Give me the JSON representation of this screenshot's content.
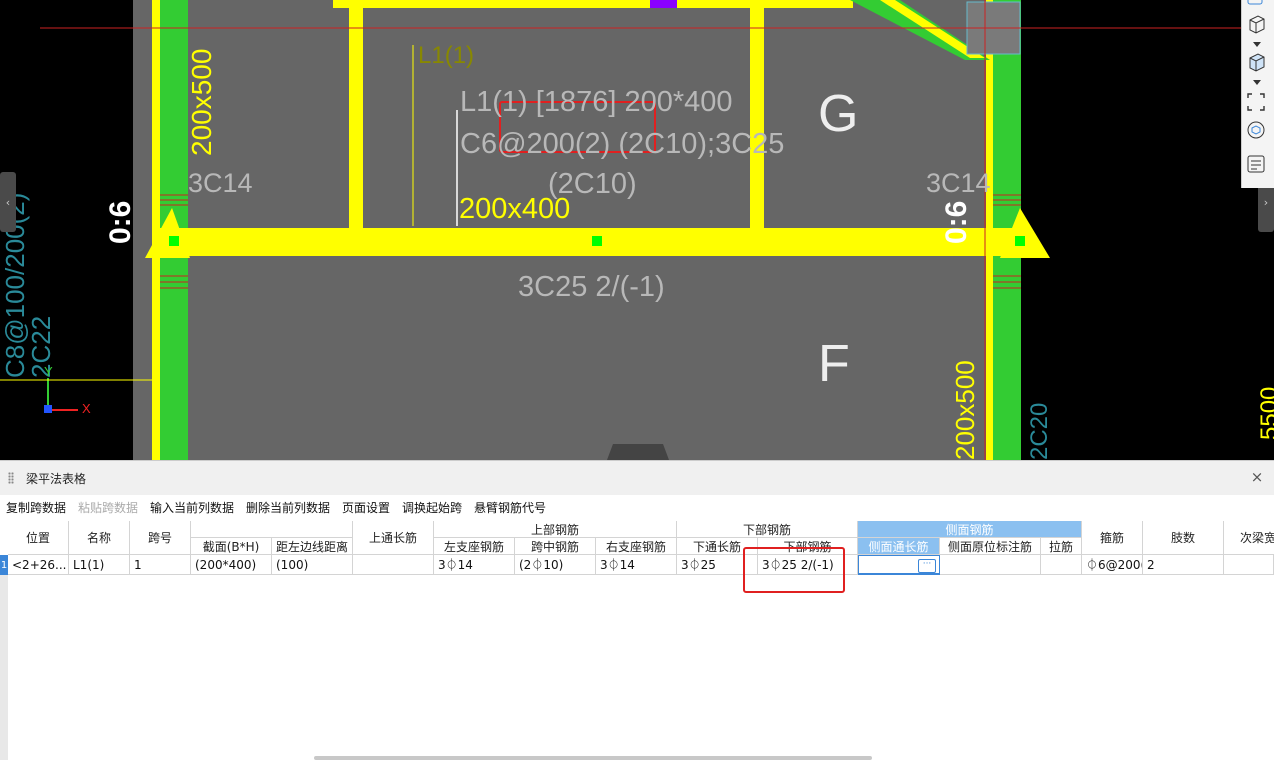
{
  "canvas": {
    "beam_label_line1": "L1(1) [1876] 200*400",
    "beam_label_line2": "C6@200(2) (2C10);3C25",
    "beam_label_line3": "(2C10)",
    "section_label": "200x400",
    "bottom_label": "3C25 2/(-1)",
    "left_section": "200x500",
    "left_rebar": "3C14",
    "right_rebar": "3C14",
    "left_dim": "0:6",
    "right_dim": "0:6",
    "axis_g": "G",
    "axis_f": "F",
    "lower_section": "200x500",
    "left_bg_text1": "C8@100/200(2)",
    "left_bg_text2": "2C22",
    "right_bg_text": "5500",
    "right_bg_text2": "2C20",
    "yellow_vertical_label": "L1(1)",
    "axis_x": "X",
    "axis_y": "Y",
    "colors": {
      "slab": "#666666",
      "beam": "#ffff00",
      "column": "#33cc33",
      "redline": "#cc2222"
    }
  },
  "toolbar_right": {
    "icons": [
      "3d-view-icon",
      "cube-icon",
      "cube-solid-icon",
      "fit-view-icon",
      "rotate-view-icon",
      "properties-list-icon"
    ]
  },
  "panel": {
    "title": "梁平法表格",
    "toolbar": [
      {
        "label": "复制跨数据",
        "enabled": true
      },
      {
        "label": "粘贴跨数据",
        "enabled": false
      },
      {
        "label": "输入当前列数据",
        "enabled": true
      },
      {
        "label": "删除当前列数据",
        "enabled": true
      },
      {
        "label": "页面设置",
        "enabled": true
      },
      {
        "label": "调换起始跨",
        "enabled": true
      },
      {
        "label": "悬臂钢筋代号",
        "enabled": true
      }
    ],
    "headers": {
      "position": "位置",
      "name": "名称",
      "span": "跨号",
      "section": "截面(B*H)",
      "offset": "距左边线距离",
      "top_through": "上通长筋",
      "top_group": "上部钢筋",
      "top_left": "左支座钢筋",
      "top_mid": "跨中钢筋",
      "top_right": "右支座钢筋",
      "bottom_group": "下部钢筋",
      "bottom_through": "下通长筋",
      "bottom_rebar": "下部钢筋",
      "side_group": "侧面钢筋",
      "side_through": "侧面通长筋",
      "side_orig": "侧面原位标注筋",
      "tie": "拉筋",
      "stirrup": "箍筋",
      "legs": "肢数",
      "secondary": "次梁宽"
    },
    "row": {
      "row_number": "1",
      "position": "<2+26...",
      "name": "L1(1)",
      "span": "1",
      "section": "(200*400)",
      "offset": "(100)",
      "top_through": "",
      "top_left": "3⏀14",
      "top_mid": "(2⏀10)",
      "top_right": "3⏀14",
      "bottom_through": "3⏀25",
      "bottom_rebar": "3⏀25 2/(-1)",
      "side_through": "",
      "side_orig": "",
      "tie": "",
      "stirrup": "⏀6@200(",
      "legs": "2",
      "secondary": ""
    },
    "ellipsis": "···",
    "close": "×"
  }
}
